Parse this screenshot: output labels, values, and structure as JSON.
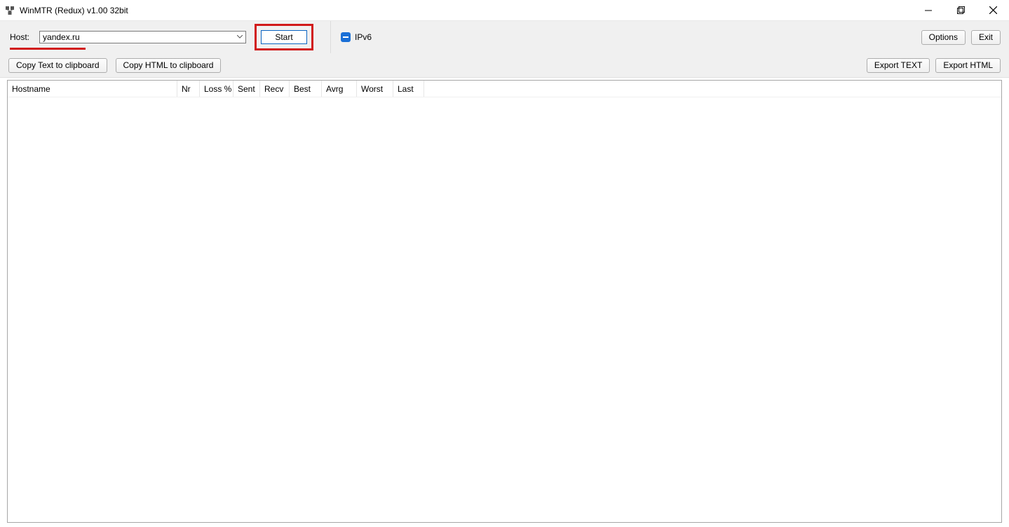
{
  "window": {
    "title": "WinMTR (Redux) v1.00 32bit"
  },
  "toolbar": {
    "host_label": "Host:",
    "host_value": "yandex.ru",
    "start_label": "Start",
    "ipv6_label": "IPv6",
    "options_label": "Options",
    "exit_label": "Exit",
    "copy_text_label": "Copy Text to clipboard",
    "copy_html_label": "Copy HTML to clipboard",
    "export_text_label": "Export TEXT",
    "export_html_label": "Export HTML"
  },
  "table": {
    "columns": [
      "Hostname",
      "Nr",
      "Loss %",
      "Sent",
      "Recv",
      "Best",
      "Avrg",
      "Worst",
      "Last"
    ],
    "rows": []
  }
}
